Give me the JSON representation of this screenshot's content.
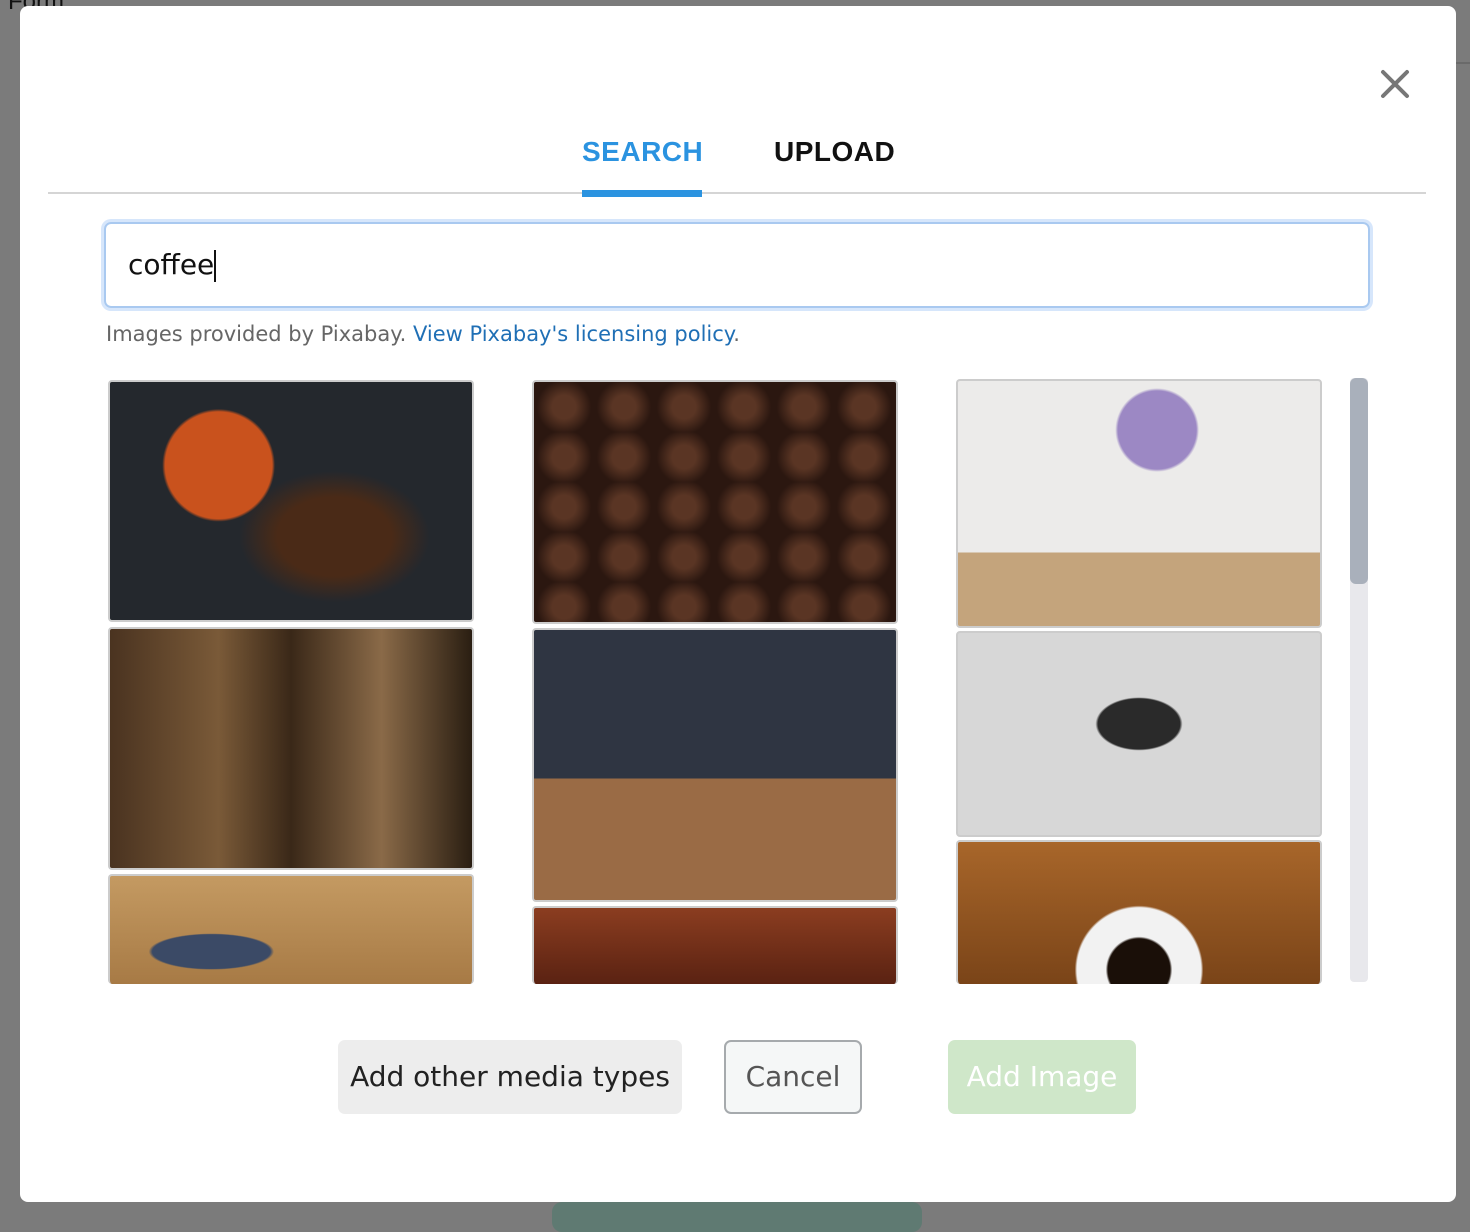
{
  "background": {
    "text": "Form"
  },
  "tabs": [
    {
      "label": "SEARCH",
      "active": true
    },
    {
      "label": "UPLOAD",
      "active": false
    }
  ],
  "search": {
    "value": "coffee"
  },
  "credit": {
    "text": "Images provided by Pixabay. ",
    "link": "View Pixabay's licensing policy",
    "suffix": "."
  },
  "colors": {
    "accent": "#2b93e0",
    "link": "#1f6fb5",
    "add_image_disabled": "#cfe7c9"
  },
  "buttons": {
    "other_media": "Add other media types",
    "cancel": "Cancel",
    "add_image": "Add Image"
  },
  "close_icon": "close-icon"
}
